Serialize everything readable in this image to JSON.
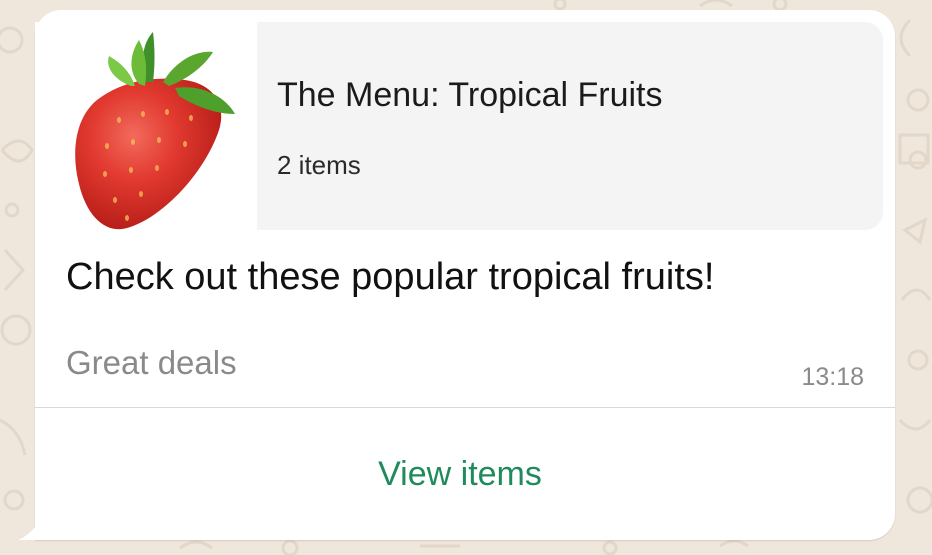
{
  "catalog": {
    "title": "The Menu: Tropical Fruits",
    "item_count": "2 items",
    "thumbnail_icon": "strawberry-image"
  },
  "message": {
    "body": "Check out these popular tropical fruits!",
    "footer": "Great deals",
    "time": "13:18"
  },
  "action": {
    "label": "View items"
  },
  "colors": {
    "chat_background": "#efe7dc",
    "bubble": "#ffffff",
    "card_info_background": "#f4f4f4",
    "action_text": "#1f8a5b",
    "meta_text": "#8a8a8a"
  }
}
